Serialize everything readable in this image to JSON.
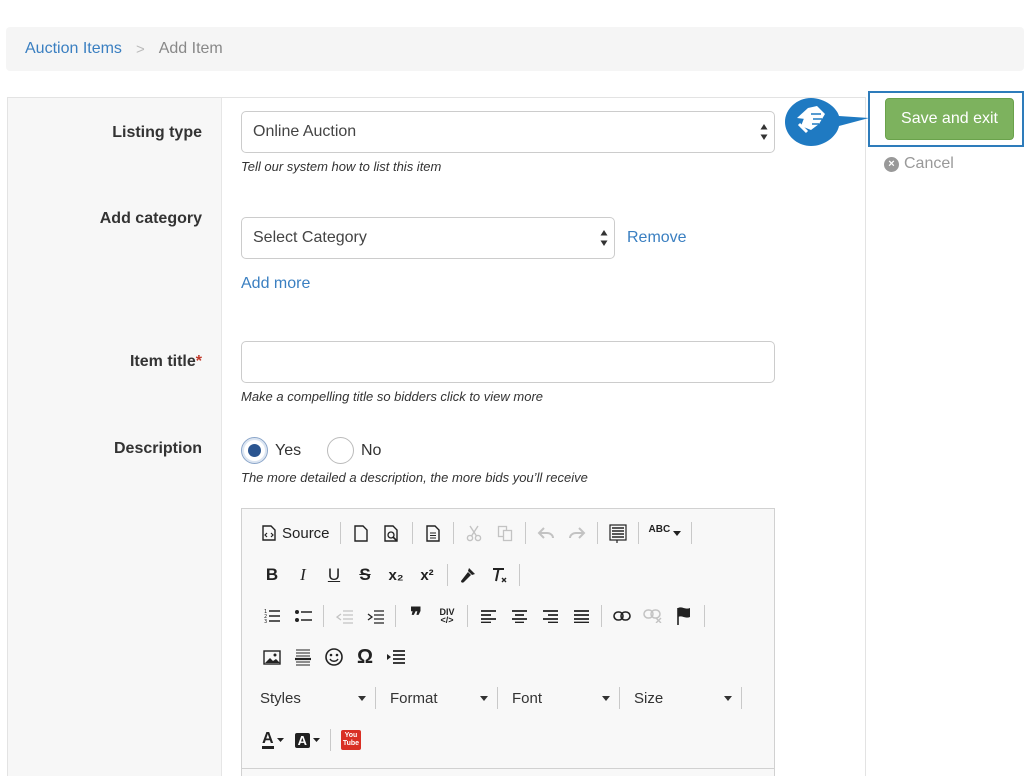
{
  "breadcrumb": {
    "parent": "Auction Items",
    "separator": ">",
    "current": "Add Item"
  },
  "form": {
    "listing_type": {
      "label": "Listing type",
      "value": "Online Auction",
      "help": "Tell our system how to list this item"
    },
    "category": {
      "label": "Add category",
      "value": "Select Category",
      "remove_label": "Remove",
      "add_more_label": "Add more"
    },
    "item_title": {
      "label": "Item title",
      "required_mark": "*",
      "value": "",
      "help": "Make a compelling title so bidders click to view more"
    },
    "description": {
      "label": "Description",
      "options": [
        {
          "label": "Yes",
          "checked": true
        },
        {
          "label": "No",
          "checked": false
        }
      ],
      "help": "The more detailed a description, the more bids you’ll receive"
    }
  },
  "editor": {
    "source_label": "Source",
    "combos": {
      "styles": "Styles",
      "format": "Format",
      "font": "Font",
      "size": "Size"
    },
    "icons": {
      "subscript_text": "x₂",
      "superscript_text": "x²",
      "blockquote_text": "❞",
      "div_text": "DIV",
      "spellcheck_text": "ABC",
      "omega_text": "Ω",
      "youtube_text": "You Tube"
    }
  },
  "actions": {
    "save_label": "Save and exit",
    "cancel_label": "Cancel"
  },
  "colors": {
    "save_button": "#7db25e",
    "link": "#3a7fc1",
    "pointer": "#1f7ac2",
    "highlight_border": "#2e7cbb"
  }
}
